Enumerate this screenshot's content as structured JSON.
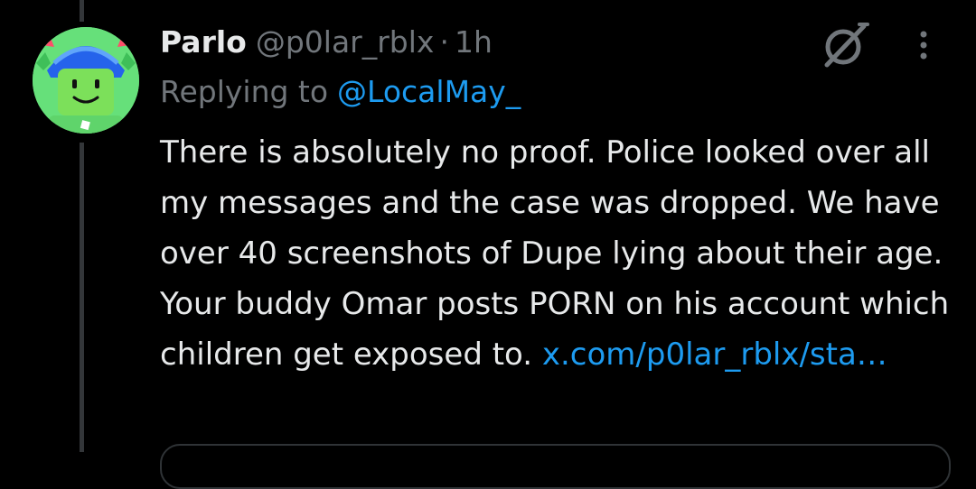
{
  "tweet": {
    "author_name": "Parlo",
    "author_handle": "@p0lar_rblx",
    "separator": "·",
    "timestamp": "1h",
    "replying_prefix": "Replying to",
    "replying_to": "@LocalMay_",
    "body": "There is absolutely no proof. Police looked over all my messages and the case was dropped. We have over 40 screenshots of Dupe lying about their age. Your buddy Omar posts PORN on his account which children get exposed to.",
    "link": "x.com/p0lar_rblx/sta…"
  },
  "icons": {
    "grok": "grok-icon",
    "more": "more-vertical-icon",
    "avatar": "roblox-avatar"
  },
  "colors": {
    "background": "#000000",
    "text_primary": "#e7e9ea",
    "text_secondary": "#71767b",
    "link": "#1d9bf0",
    "thread_line": "#333639",
    "avatar_bg": "#66e07a"
  }
}
